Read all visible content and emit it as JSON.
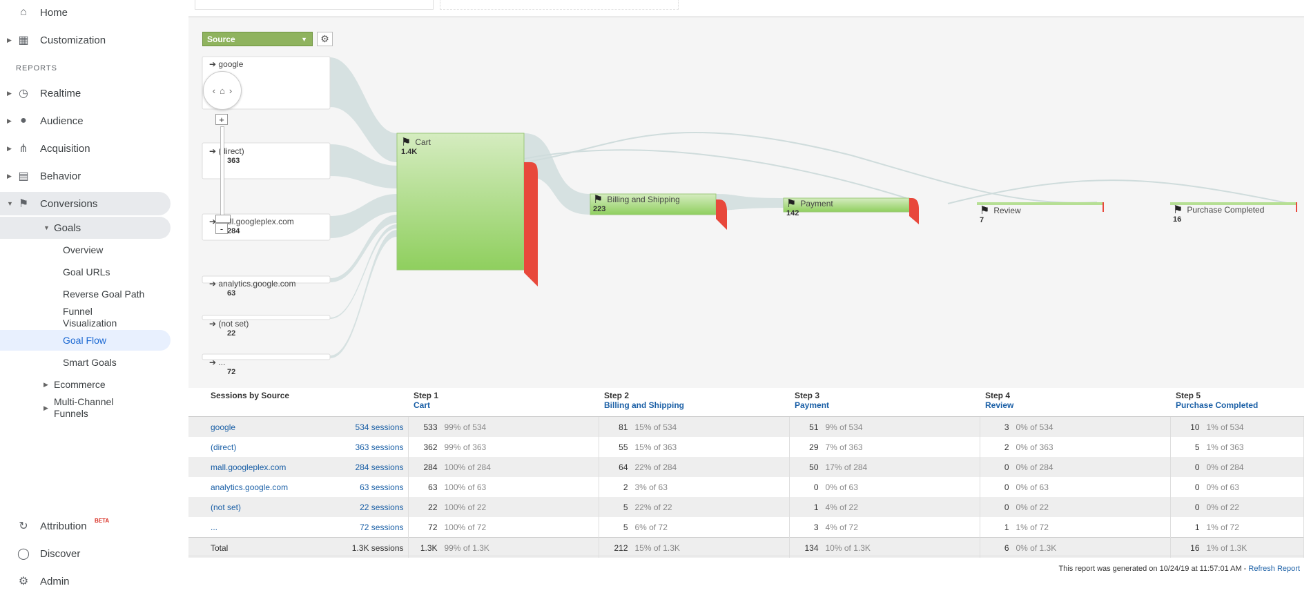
{
  "sidebar": {
    "home": "Home",
    "customization": "Customization",
    "reports_label": "REPORTS",
    "realtime": "Realtime",
    "audience": "Audience",
    "acquisition": "Acquisition",
    "behavior": "Behavior",
    "conversions": "Conversions",
    "goals": "Goals",
    "goal_items": [
      "Overview",
      "Goal URLs",
      "Reverse Goal Path",
      "Funnel Visualization",
      "Goal Flow",
      "Smart Goals"
    ],
    "ecommerce": "Ecommerce",
    "multichannel": "Multi-Channel Funnels",
    "attribution": "Attribution",
    "beta": "BETA",
    "discover": "Discover",
    "admin": "Admin"
  },
  "flow": {
    "dimension": "Source",
    "sources": [
      {
        "name": "google",
        "value": ""
      },
      {
        "name": "(direct)",
        "value": "363"
      },
      {
        "name": "mall.googleplex.com",
        "value": "284"
      },
      {
        "name": "analytics.google.com",
        "value": "63"
      },
      {
        "name": "(not set)",
        "value": "22"
      },
      {
        "name": "...",
        "value": "72"
      }
    ],
    "steps": [
      {
        "name": "Cart",
        "value": "1.4K"
      },
      {
        "name": "Billing and Shipping",
        "value": "223"
      },
      {
        "name": "Payment",
        "value": "142"
      },
      {
        "name": "Review",
        "value": "7"
      },
      {
        "name": "Purchase Completed",
        "value": "16"
      }
    ],
    "zoom_plus": "+",
    "zoom_minus": "-"
  },
  "table": {
    "first_header": "Sessions by Source",
    "steps": [
      {
        "step": "Step 1",
        "name": "Cart"
      },
      {
        "step": "Step 2",
        "name": "Billing and Shipping"
      },
      {
        "step": "Step 3",
        "name": "Payment"
      },
      {
        "step": "Step 4",
        "name": "Review"
      },
      {
        "step": "Step 5",
        "name": "Purchase Completed"
      }
    ],
    "rows": [
      {
        "source": "google",
        "sessions": "534 sessions",
        "cells": [
          [
            "533",
            "99% of 534"
          ],
          [
            "81",
            "15% of 534"
          ],
          [
            "51",
            "9% of 534"
          ],
          [
            "3",
            "0% of 534"
          ],
          [
            "10",
            "1% of 534"
          ]
        ]
      },
      {
        "source": "(direct)",
        "sessions": "363 sessions",
        "cells": [
          [
            "362",
            "99% of 363"
          ],
          [
            "55",
            "15% of 363"
          ],
          [
            "29",
            "7% of 363"
          ],
          [
            "2",
            "0% of 363"
          ],
          [
            "5",
            "1% of 363"
          ]
        ]
      },
      {
        "source": "mall.googleplex.com",
        "sessions": "284 sessions",
        "cells": [
          [
            "284",
            "100% of 284"
          ],
          [
            "64",
            "22% of 284"
          ],
          [
            "50",
            "17% of 284"
          ],
          [
            "0",
            "0% of 284"
          ],
          [
            "0",
            "0% of 284"
          ]
        ]
      },
      {
        "source": "analytics.google.com",
        "sessions": "63 sessions",
        "cells": [
          [
            "63",
            "100% of 63"
          ],
          [
            "2",
            "3% of 63"
          ],
          [
            "0",
            "0% of 63"
          ],
          [
            "0",
            "0% of 63"
          ],
          [
            "0",
            "0% of 63"
          ]
        ]
      },
      {
        "source": "(not set)",
        "sessions": "22 sessions",
        "cells": [
          [
            "22",
            "100% of 22"
          ],
          [
            "5",
            "22% of 22"
          ],
          [
            "1",
            "4% of 22"
          ],
          [
            "0",
            "0% of 22"
          ],
          [
            "0",
            "0% of 22"
          ]
        ]
      },
      {
        "source": "...",
        "sessions": "72 sessions",
        "cells": [
          [
            "72",
            "100% of 72"
          ],
          [
            "5",
            "6% of 72"
          ],
          [
            "3",
            "4% of 72"
          ],
          [
            "1",
            "1% of 72"
          ],
          [
            "1",
            "1% of 72"
          ]
        ]
      }
    ],
    "total": {
      "label": "Total",
      "sessions": "1.3K sessions",
      "cells": [
        [
          "1.3K",
          "99% of 1.3K"
        ],
        [
          "212",
          "15% of 1.3K"
        ],
        [
          "134",
          "10% of 1.3K"
        ],
        [
          "6",
          "0% of 1.3K"
        ],
        [
          "16",
          "1% of 1.3K"
        ]
      ]
    }
  },
  "footer": {
    "text": "This report was generated on 10/24/19 at 11:57:01 AM - ",
    "refresh": "Refresh Report"
  }
}
